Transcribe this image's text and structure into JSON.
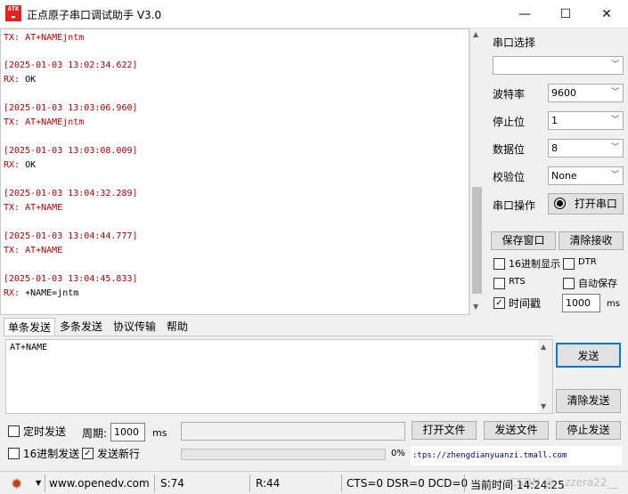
{
  "title_bar": {
    "logo_text": "ATK\nALIENTEK",
    "title": "正点原子串口调试助手 V3.0",
    "minimize": "—",
    "maximize": "☐",
    "close": "✕"
  },
  "log": [
    {
      "kind": "tx",
      "text": "TX: AT+NAMEjntm"
    },
    {
      "kind": "ts",
      "text": "[2025-01-03 13:02:34.622]"
    },
    {
      "kind": "rx",
      "label": "RX:",
      "text": " OK"
    },
    {
      "kind": "ts",
      "text": "[2025-01-03 13:03:06.960]"
    },
    {
      "kind": "tx",
      "text": "TX: AT+NAMEjntm"
    },
    {
      "kind": "ts",
      "text": "[2025-01-03 13:03:08.009]"
    },
    {
      "kind": "rx",
      "label": "RX:",
      "text": " OK"
    },
    {
      "kind": "ts",
      "text": "[2025-01-03 13:04:32.289]"
    },
    {
      "kind": "tx",
      "text": "TX: AT+NAME"
    },
    {
      "kind": "ts",
      "text": "[2025-01-03 13:04:44.777]"
    },
    {
      "kind": "tx",
      "text": "TX: AT+NAME"
    },
    {
      "kind": "ts",
      "text": "[2025-01-03 13:04:45.833]"
    },
    {
      "kind": "rx",
      "label": "RX:",
      "text": " +NAME=jntm"
    }
  ],
  "panel": {
    "port_select_label": "串口选择",
    "port_value": "",
    "baud_label": "波特率",
    "baud_value": "9600",
    "stop_label": "停止位",
    "stop_value": "1",
    "data_label": "数据位",
    "data_value": "8",
    "parity_label": "校验位",
    "parity_value": "None",
    "port_op_label": "串口操作",
    "open_port_button": "打开串口",
    "save_window_button": "保存窗口",
    "clear_rx_button": "清除接收",
    "hex_display_label": "16进制显示",
    "hex_display_checked": false,
    "dtr_label": "DTR",
    "dtr_checked": false,
    "rts_label": "RTS",
    "rts_checked": false,
    "auto_save_label": "自动保存",
    "auto_save_checked": false,
    "timestamp_label": "时间戳",
    "timestamp_checked": true,
    "timestamp_value": "1000",
    "timestamp_unit": "ms"
  },
  "tabs": [
    "单条发送",
    "多条发送",
    "协议传输",
    "帮助"
  ],
  "send": {
    "text": "AT+NAME",
    "send_button": "发送",
    "clear_send_button": "清除发送",
    "timed_send_label": "定时发送",
    "timed_send_checked": false,
    "period_label": "周期:",
    "period_value": "1000",
    "period_unit": "ms",
    "file_path": "",
    "open_file_button": "打开文件",
    "send_file_button": "发送文件",
    "stop_send_button": "停止发送",
    "hex_send_label": "16进制发送",
    "hex_send_checked": false,
    "newline_label": "发送新行",
    "newline_checked": true,
    "progress_text": "0%",
    "progress": 0,
    "shop_link": ":tps://zhengdianyuanzi.tmall.com"
  },
  "status_bar": {
    "website": "www.openedv.com",
    "sent": "S:74",
    "received": "R:44",
    "signals": "CTS=0 DSR=0 DCD=0",
    "time": "当前时间 14:24:25",
    "watermark": "CSDN @__zzera22__"
  }
}
